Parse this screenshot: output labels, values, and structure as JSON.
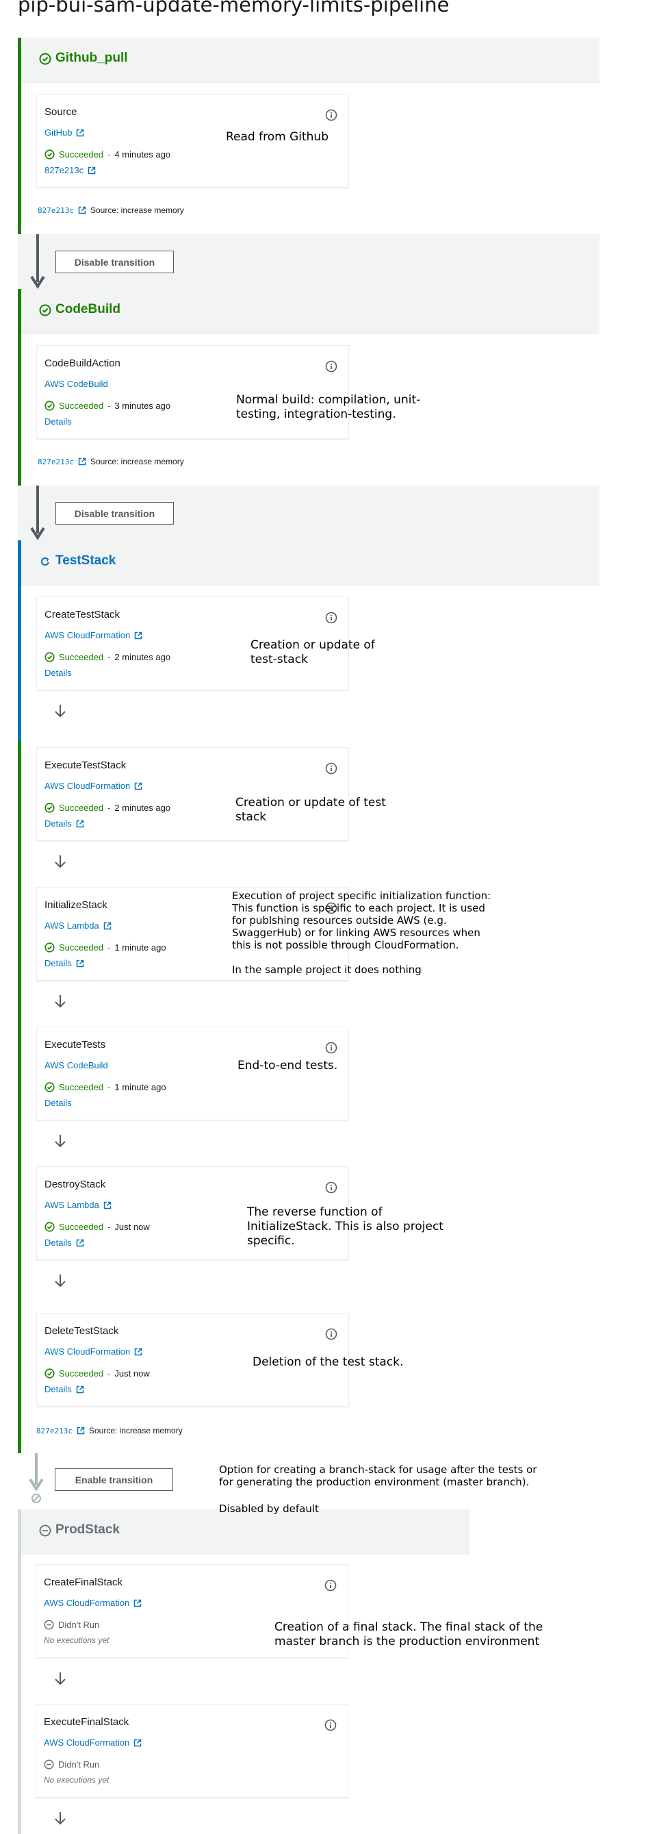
{
  "pipeline": {
    "title": "pip-bui-sam-update-memory-limits-pipeline"
  },
  "colors": {
    "success": "#1d8102",
    "in_progress": "#0073bb",
    "disabled": "#879196",
    "link": "#0073bb"
  },
  "stages": {
    "github_pull": {
      "name": "Github_pull",
      "status_icon": "check-circle-icon",
      "revision": {
        "id": "827e213c",
        "message": "Source: increase memory"
      },
      "actions": [
        {
          "name": "Source",
          "provider": "GitHub",
          "status": "Succeeded",
          "time": "4 minutes ago",
          "link": "827e213c"
        }
      ]
    },
    "codebuild": {
      "name": "CodeBuild",
      "status_icon": "check-circle-icon",
      "revision": {
        "id": "827e213c",
        "message": "Source: increase memory"
      },
      "actions": [
        {
          "name": "CodeBuildAction",
          "provider": "AWS CodeBuild",
          "status": "Succeeded",
          "time": "3 minutes ago",
          "link": "Details"
        }
      ]
    },
    "teststack": {
      "name": "TestStack",
      "status_icon": "in-progress-icon",
      "revision": {
        "id": "827e213c",
        "message": "Source: increase memory"
      },
      "actions": [
        {
          "name": "CreateTestStack",
          "provider": "AWS CloudFormation",
          "status": "Succeeded",
          "time": "2 minutes ago",
          "link": "Details"
        },
        {
          "name": "ExecuteTestStack",
          "provider": "AWS CloudFormation",
          "status": "Succeeded",
          "time": "2 minutes ago",
          "link": "Details"
        },
        {
          "name": "InitializeStack",
          "provider": "AWS Lambda",
          "status": "Succeeded",
          "time": "1 minute ago",
          "link": "Details"
        },
        {
          "name": "ExecuteTests",
          "provider": "AWS CodeBuild",
          "status": "Succeeded",
          "time": "1 minute ago",
          "link": "Details"
        },
        {
          "name": "DestroyStack",
          "provider": "AWS Lambda",
          "status": "Succeeded",
          "time": "Just now",
          "link": "Details"
        },
        {
          "name": "DeleteTestStack",
          "provider": "AWS CloudFormation",
          "status": "Succeeded",
          "time": "Just now",
          "link": "Details"
        }
      ]
    },
    "prodstack": {
      "name": "ProdStack",
      "status_icon": "disabled-icon",
      "actions": [
        {
          "name": "CreateFinalStack",
          "provider": "AWS CloudFormation",
          "status": "Didn't Run",
          "note": "No executions yet"
        },
        {
          "name": "ExecuteFinalStack",
          "provider": "AWS CloudFormation",
          "status": "Didn't Run",
          "note": "No executions yet"
        }
      ]
    }
  },
  "transitions": {
    "t1": {
      "label": "Disable transition"
    },
    "t2": {
      "label": "Disable transition"
    },
    "t3": {
      "label": "Enable transition"
    }
  },
  "annotations": {
    "source": "Read from Github",
    "build": "Normal build: compilation, unit-\ntesting, integration-testing.",
    "create_test": "Creation or update of\ntest-stack",
    "execute_test": "Creation or update of test\nstack",
    "initialize": "Execution of project specific initialization function:\nThis function is specific to each project. It is used\nfor publshing resources outside AWS (e.g.\nSwaggerHub) or for linking AWS resources when\nthis is not possible through CloudFormation.",
    "initialize_note": "In the sample project it does nothing",
    "execute_tests": "End-to-end tests.",
    "destroy": "The reverse function of\nInitializeStack. This is also project\nspecific.",
    "delete": "Deletion of the test stack.",
    "enable_transition": "Option for creating a branch-stack for usage after the tests or\nfor generating the production environment (master branch).",
    "enable_note": "Disabled by default",
    "create_final": "Creation of a final stack. The final stack of the\nmaster branch is the production environment"
  }
}
